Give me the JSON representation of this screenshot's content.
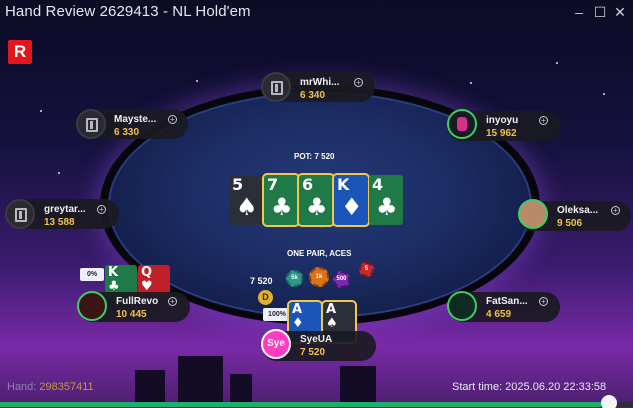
{
  "window": {
    "title": "Hand Review 2629413 - NL Hold'em",
    "minimize": "–",
    "maximize": "☐",
    "close": "✕"
  },
  "logo": {
    "letter": "R",
    "color": "#e2161d"
  },
  "pot": {
    "label": "POT: 7 520"
  },
  "board": [
    {
      "rank": "5",
      "suit": "♠",
      "suit_name": "spade-icon",
      "color": "spade",
      "highlight": false
    },
    {
      "rank": "7",
      "suit": "♣",
      "suit_name": "club-icon",
      "color": "club",
      "highlight": true
    },
    {
      "rank": "6",
      "suit": "♣",
      "suit_name": "club-icon",
      "color": "club",
      "highlight": true
    },
    {
      "rank": "K",
      "suit": "♦",
      "suit_name": "diamond-icon",
      "color": "diam",
      "highlight": true
    },
    {
      "rank": "4",
      "suit": "♣",
      "suit_name": "club-icon",
      "color": "club",
      "highlight": false
    }
  ],
  "hand_result": "ONE PAIR, ACES",
  "seats": {
    "top": {
      "name": "mrWhi...",
      "stack": "6 340"
    },
    "upper_left": {
      "name": "Mayste...",
      "stack": "6 330"
    },
    "upper_right": {
      "name": "inyoyu",
      "stack": "15 962"
    },
    "left": {
      "name": "greytar...",
      "stack": "13 588"
    },
    "right": {
      "name": "Oleksa...",
      "stack": "9 506"
    },
    "lower_left": {
      "name": "FullRevo",
      "stack": "10 445",
      "equity": "0%",
      "cards": [
        {
          "rank": "K",
          "suit": "♣"
        },
        {
          "rank": "Q",
          "suit": "♥"
        }
      ]
    },
    "lower_right": {
      "name": "FatSan...",
      "stack": "4 659"
    },
    "hero": {
      "name": "SyeUA",
      "stack": "7 520",
      "avatar_text": "Sye",
      "equity": "100%",
      "cards": [
        {
          "rank": "A",
          "suit": "♦"
        },
        {
          "rank": "A",
          "suit": "♠"
        }
      ]
    }
  },
  "bet": {
    "amount": "7 520",
    "dealer": "D",
    "chips": [
      "5k",
      "1k",
      "500",
      "5"
    ]
  },
  "footer": {
    "hand_label": "Hand:",
    "hand_number": "298357411",
    "start_time": "Start time: 2025.06.20 22:33:58"
  },
  "replay": {
    "progress": 0.95
  }
}
